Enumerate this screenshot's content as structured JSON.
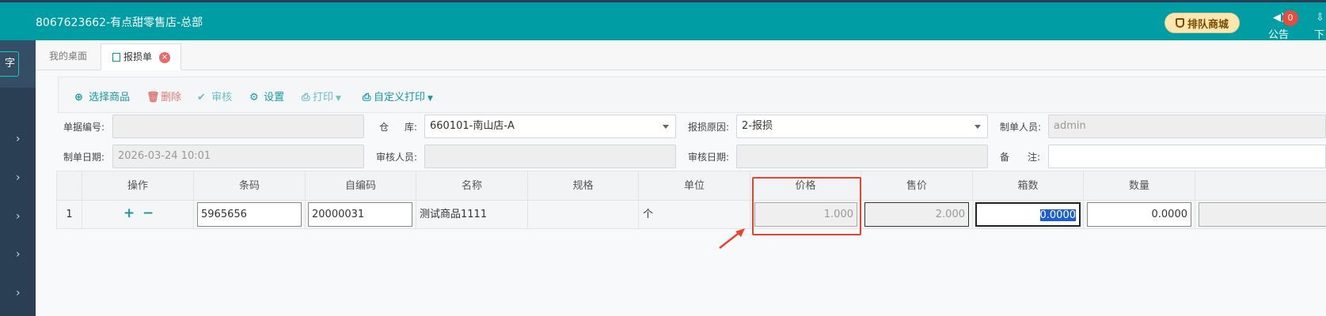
{
  "header": {
    "title": "8067623662-有点甜零售店-总部",
    "queue_button": "排队商城",
    "notice_label": "公告",
    "notice_count": "0",
    "download_label": "下"
  },
  "sidebar": {
    "top_button": "字"
  },
  "tabs": {
    "home": "我的桌面",
    "active": "报损单",
    "close_glyph": "×"
  },
  "toolbar": {
    "select_goods": "选择商品",
    "delete": "删除",
    "audit": "审核",
    "settings": "设置",
    "print": "打印",
    "custom_print": "自定义打印"
  },
  "form": {
    "doc_no_label": "单据编号:",
    "doc_no_value": "",
    "warehouse_label_1": "仓",
    "warehouse_label_2": "库:",
    "warehouse_value": "660101-南山店-A",
    "reason_label": "报损原因:",
    "reason_value": "2-报损",
    "creator_label": "制单人员:",
    "creator_value": "admin",
    "date_label": "制单日期:",
    "date_value": "2026-03-24 10:01",
    "auditor_label": "审核人员:",
    "auditor_value": "",
    "audit_date_label": "审核日期:",
    "audit_date_value": "",
    "remark_label_1": "备",
    "remark_label_2": "注:",
    "remark_value": ""
  },
  "grid": {
    "headers": [
      "操作",
      "条码",
      "自编码",
      "名称",
      "规格",
      "单位",
      "价格",
      "售价",
      "箱数",
      "数量"
    ],
    "row": {
      "index": "1",
      "add": "+",
      "remove": "−",
      "barcode": "5965656",
      "self_code": "20000031",
      "name": "测试商品1111",
      "spec": "",
      "unit": "个",
      "price": "1.000",
      "sale_price": "2.000",
      "boxes": "0.0000",
      "quantity": "0.0000"
    }
  },
  "colors": {
    "header_bg": "#009ea4",
    "sidebar_bg": "#2a3f54",
    "accent": "#179a9f",
    "annotation": "#e8432f"
  }
}
